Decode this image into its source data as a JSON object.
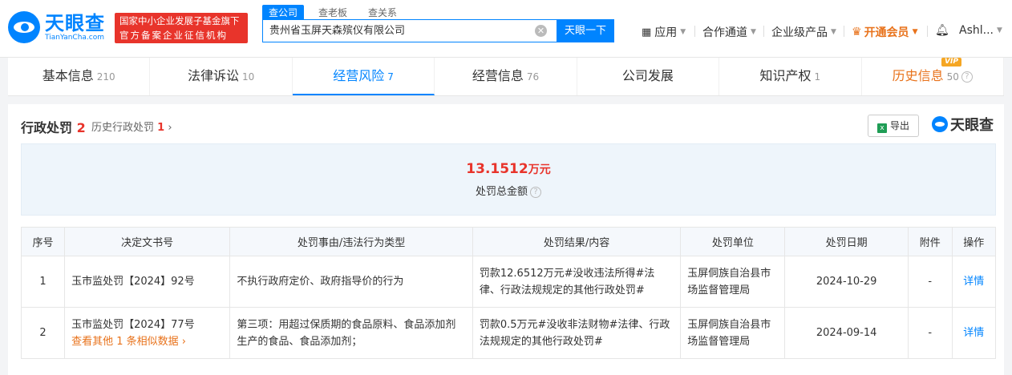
{
  "header": {
    "logo_cn": "天眼查",
    "logo_en": "TianYanCha.com",
    "badge_line1": "国家中小企业发展子基金旗下",
    "badge_line2": "官方备案企业征信机构",
    "search_tabs": [
      "查公司",
      "查老板",
      "查关系"
    ],
    "search_value": "贵州省玉屏天森殡仪有限公司",
    "search_button": "天眼一下",
    "nav": {
      "apps": "应用",
      "partner": "合作通道",
      "enterprise": "企业级产品",
      "vip": "开通会员",
      "user": "Ashl..."
    }
  },
  "tabs": [
    {
      "label": "基本信息",
      "count": "210"
    },
    {
      "label": "法律诉讼",
      "count": "10"
    },
    {
      "label": "经营风险",
      "count": "7"
    },
    {
      "label": "经营信息",
      "count": "76"
    },
    {
      "label": "公司发展",
      "count": ""
    },
    {
      "label": "知识产权",
      "count": "1"
    },
    {
      "label": "历史信息",
      "count": "50"
    }
  ],
  "vip_tag": "VIP",
  "section": {
    "title": "行政处罚",
    "count": "2",
    "history_label": "历史行政处罚",
    "history_count": "1",
    "export_label": "导出",
    "watermark": "天眼查"
  },
  "summary": {
    "amount": "13.1512",
    "unit": "万元",
    "label": "处罚总金额"
  },
  "table": {
    "headers": [
      "序号",
      "决定文书号",
      "处罚事由/违法行为类型",
      "处罚结果/内容",
      "处罚单位",
      "处罚日期",
      "附件",
      "操作"
    ],
    "rows": [
      {
        "no": "1",
        "doc": "玉市监处罚【2024】92号",
        "reason": "不执行政府定价、政府指导价的行为",
        "result": "罚款12.6512万元#没收违法所得#法律、行政法规规定的其他行政处罚#",
        "unit": "玉屏侗族自治县市场监督管理局",
        "date": "2024-10-29",
        "attach": "-",
        "action": "详情"
      },
      {
        "no": "2",
        "doc": "玉市监处罚【2024】77号",
        "more": "查看其他 1 条相似数据",
        "reason": "第三项：用超过保质期的食品原料、食品添加剂生产的食品、食品添加剂；",
        "result": "罚款0.5万元#没收非法财物#法律、行政法规规定的其他行政处罚#",
        "unit": "玉屏侗族自治县市场监督管理局",
        "date": "2024-09-14",
        "attach": "-",
        "action": "详情"
      }
    ]
  }
}
